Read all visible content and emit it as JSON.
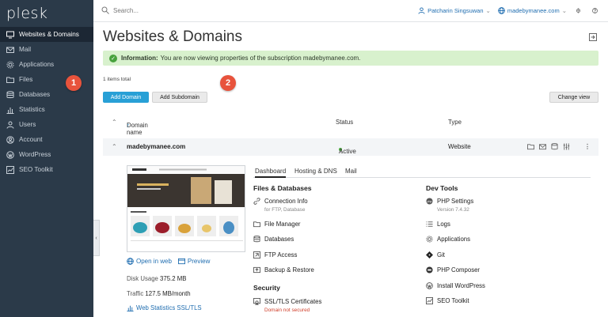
{
  "sidebar": {
    "logo": "plesk",
    "items": [
      {
        "label": "Websites & Domains",
        "icon": "monitor-icon"
      },
      {
        "label": "Mail",
        "icon": "envelope-icon"
      },
      {
        "label": "Applications",
        "icon": "gear-icon"
      },
      {
        "label": "Files",
        "icon": "folder-icon"
      },
      {
        "label": "Databases",
        "icon": "database-icon"
      },
      {
        "label": "Statistics",
        "icon": "bar-chart-icon"
      },
      {
        "label": "Users",
        "icon": "user-icon"
      },
      {
        "label": "Account",
        "icon": "account-icon"
      },
      {
        "label": "WordPress",
        "icon": "wordpress-icon"
      },
      {
        "label": "SEO Toolkit",
        "icon": "seo-icon"
      }
    ],
    "collapse": "‹"
  },
  "callouts": {
    "one": "1",
    "two": "2"
  },
  "topbar": {
    "search_placeholder": "Search...",
    "user": "Patcharin Singsuwan",
    "domain": "madebymanee.com"
  },
  "main": {
    "title": "Websites & Domains",
    "info_label": "Information:",
    "info_text": "You are now viewing properties of the subscription madebymanee.com.",
    "items_total": "1 items total",
    "add_domain": "Add Domain",
    "add_subdomain": "Add Subdomain",
    "change_view": "Change view"
  },
  "table": {
    "col_domain": "Domain name",
    "sort_arrow": "↑",
    "col_status": "Status",
    "col_type": "Type",
    "row": {
      "domain": "madebymanee.com",
      "status": "Active",
      "type": "Website"
    }
  },
  "details": {
    "open_in_web": "Open in web",
    "preview": "Preview",
    "disk_usage_label": "Disk Usage",
    "disk_usage_value": "375.2 MB",
    "traffic_label": "Traffic",
    "traffic_value": "127.5 MB/month",
    "web_stats": "Web Statistics SSL/TLS",
    "tabs": [
      "Dashboard",
      "Hosting & DNS",
      "Mail"
    ],
    "files_db_title": "Files & Databases",
    "connection_info": "Connection Info",
    "connection_sub": "for FTP, Database",
    "file_manager": "File Manager",
    "databases": "Databases",
    "ftp_access": "FTP Access",
    "backup_restore": "Backup & Restore",
    "security_title": "Security",
    "ssl_certs": "SSL/TLS Certificates",
    "ssl_sub": "Domain not secured",
    "dev_tools_title": "Dev Tools",
    "php_settings": "PHP Settings",
    "php_version": "Version 7.4.32",
    "logs": "Logs",
    "applications": "Applications",
    "git": "Git",
    "php_composer": "PHP Composer",
    "install_wordpress": "Install WordPress",
    "seo_toolkit": "SEO Toolkit"
  }
}
